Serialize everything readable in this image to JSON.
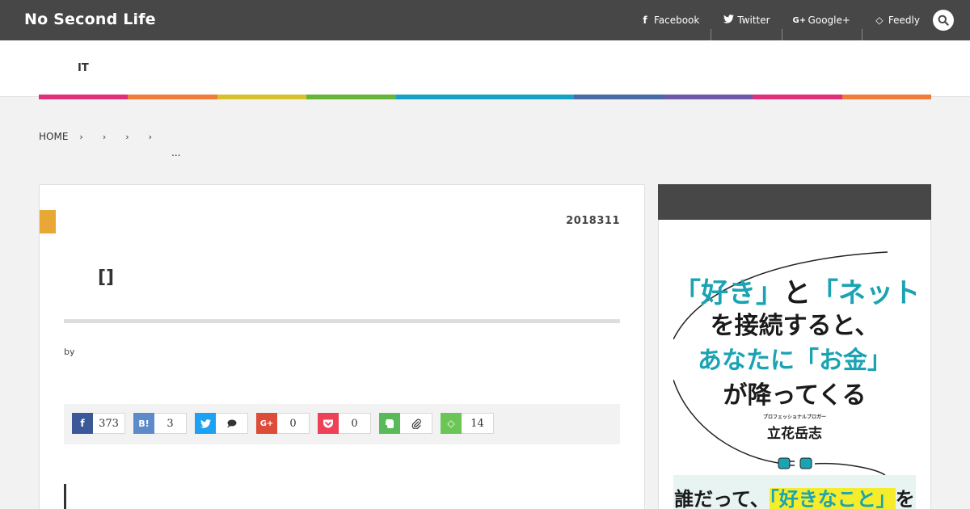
{
  "header": {
    "site_title": "No Second Life",
    "social": [
      {
        "icon": "facebook-icon",
        "glyph": "f",
        "label": "Facebook"
      },
      {
        "icon": "twitter-icon",
        "glyph": "t",
        "label": "Twitter"
      },
      {
        "icon": "google-plus-icon",
        "glyph": "G+",
        "label": "Google+"
      },
      {
        "icon": "feedly-icon",
        "glyph": "◇",
        "label": "Feedly"
      }
    ],
    "search_icon": "search-icon"
  },
  "nav": {
    "items": [
      "IT"
    ],
    "stripe_colors": [
      "#e0307a",
      "#ee7d3a",
      "#d8c12f",
      "#68b339",
      "#16a2c8",
      "#16a2c8",
      "#4a6aa6",
      "#6c5aa8",
      "#e0307a",
      "#ee7d3a"
    ]
  },
  "breadcrumb": {
    "home": "HOME",
    "separator": "›",
    "ellipsis": "..."
  },
  "article": {
    "category_color": "#e8a838",
    "date": "2018311",
    "title": "[]",
    "author_prefix": "by",
    "share": [
      {
        "service": "facebook",
        "icon": "facebook-icon",
        "glyph": "f",
        "color": "#3b5998",
        "count": "373"
      },
      {
        "service": "hatena",
        "icon": "hatena-bookmark-icon",
        "glyph": "B!",
        "color": "#5d8ac8",
        "count": "3"
      },
      {
        "service": "twitter",
        "icon": "twitter-icon",
        "glyph": "t",
        "color": "#1da1f2",
        "count": "",
        "count_icon": "speech-bubble-icon"
      },
      {
        "service": "google-plus",
        "icon": "google-plus-icon",
        "glyph": "G+",
        "color": "#dd4b39",
        "count": "0"
      },
      {
        "service": "pocket",
        "icon": "pocket-icon",
        "glyph": "❤",
        "color": "#ee4056",
        "count": "0"
      },
      {
        "service": "evernote",
        "icon": "evernote-icon",
        "glyph": "E",
        "color": "#5aba59",
        "count": "",
        "count_icon": "paperclip-icon"
      },
      {
        "service": "feedly",
        "icon": "feedly-icon",
        "glyph": "◇",
        "color": "#6cc655",
        "count": "14"
      }
    ]
  },
  "sidebar": {
    "book": {
      "line1_a": "「好き」",
      "line1_b": "と",
      "line1_c": "「ネット」",
      "line2": "を接続すると、",
      "line3_a": "あなたに",
      "line3_b": "「お金」",
      "line4": "が降ってくる",
      "author_small": "プロフェッショナルブロガー",
      "author": "立花岳志",
      "line5_a": "誰だって、",
      "line5_b": "「好きなこと」",
      "line5_c": "を"
    }
  }
}
